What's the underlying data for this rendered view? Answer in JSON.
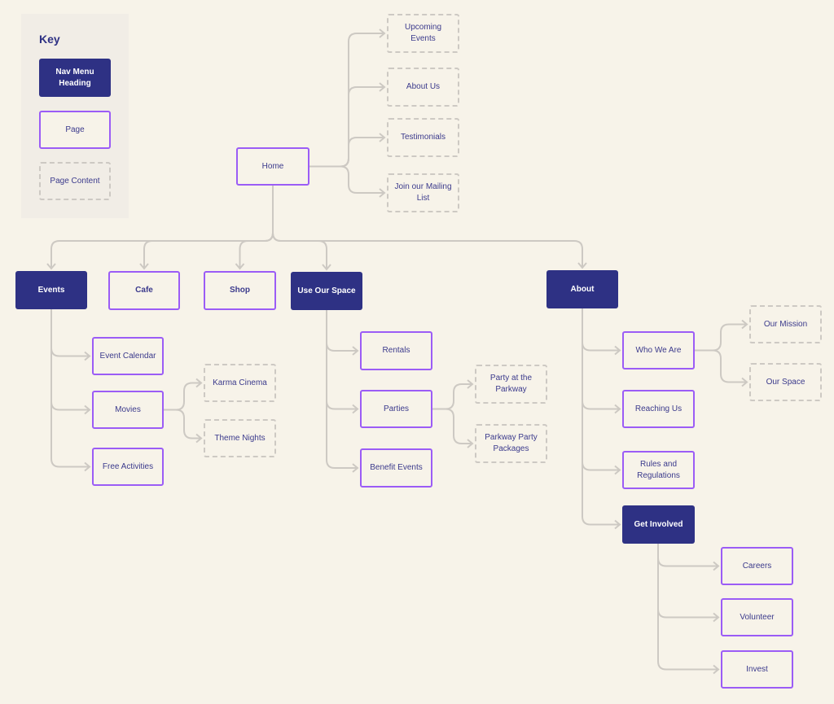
{
  "key": {
    "title": "Key",
    "nav_menu_heading": "Nav Menu Heading",
    "page": "Page",
    "page_content": "Page Content"
  },
  "colors": {
    "background": "#f7f3e9",
    "nav_heading": "#2e3184",
    "page_border": "#9b5cf6",
    "content_border": "#cdc9c3",
    "connector": "#cdc9c3",
    "text": "#3b3a8c"
  },
  "nodes": {
    "home": {
      "label": "Home",
      "type": "page"
    },
    "upcoming": {
      "label": "Upcoming Events",
      "type": "content"
    },
    "aboutus": {
      "label": "About Us",
      "type": "content"
    },
    "testimonials": {
      "label": "Testimonials",
      "type": "content"
    },
    "mailing": {
      "label": "Join our Mailing List",
      "type": "content"
    },
    "events": {
      "label": "Events",
      "type": "nav"
    },
    "cafe": {
      "label": "Cafe",
      "type": "page"
    },
    "shop": {
      "label": "Shop",
      "type": "page"
    },
    "useourspace": {
      "label": "Use Our Space",
      "type": "nav"
    },
    "about": {
      "label": "About",
      "type": "nav"
    },
    "calendar": {
      "label": "Event Calendar",
      "type": "page"
    },
    "movies": {
      "label": "Movies",
      "type": "page"
    },
    "free": {
      "label": "Free Activities",
      "type": "page"
    },
    "karma": {
      "label": "Karma Cinema",
      "type": "content"
    },
    "theme": {
      "label": "Theme Nights",
      "type": "content"
    },
    "rentals": {
      "label": "Rentals",
      "type": "page"
    },
    "parties": {
      "label": "Parties",
      "type": "page"
    },
    "benefit": {
      "label": "Benefit Events",
      "type": "page"
    },
    "partypark": {
      "label": "Party at the Parkway",
      "type": "content"
    },
    "packages": {
      "label": "Parkway Party Packages",
      "type": "content"
    },
    "whoweare": {
      "label": "Who We Are",
      "type": "page"
    },
    "reaching": {
      "label": "Reaching Us",
      "type": "page"
    },
    "rules": {
      "label": "Rules and Regulations",
      "type": "page"
    },
    "involved": {
      "label": "Get Involved",
      "type": "nav"
    },
    "mission": {
      "label": "Our Mission",
      "type": "content"
    },
    "ourspace": {
      "label": "Our Space",
      "type": "content"
    },
    "careers": {
      "label": "Careers",
      "type": "page"
    },
    "volunteer": {
      "label": "Volunteer",
      "type": "page"
    },
    "invest": {
      "label": "Invest",
      "type": "page"
    }
  }
}
